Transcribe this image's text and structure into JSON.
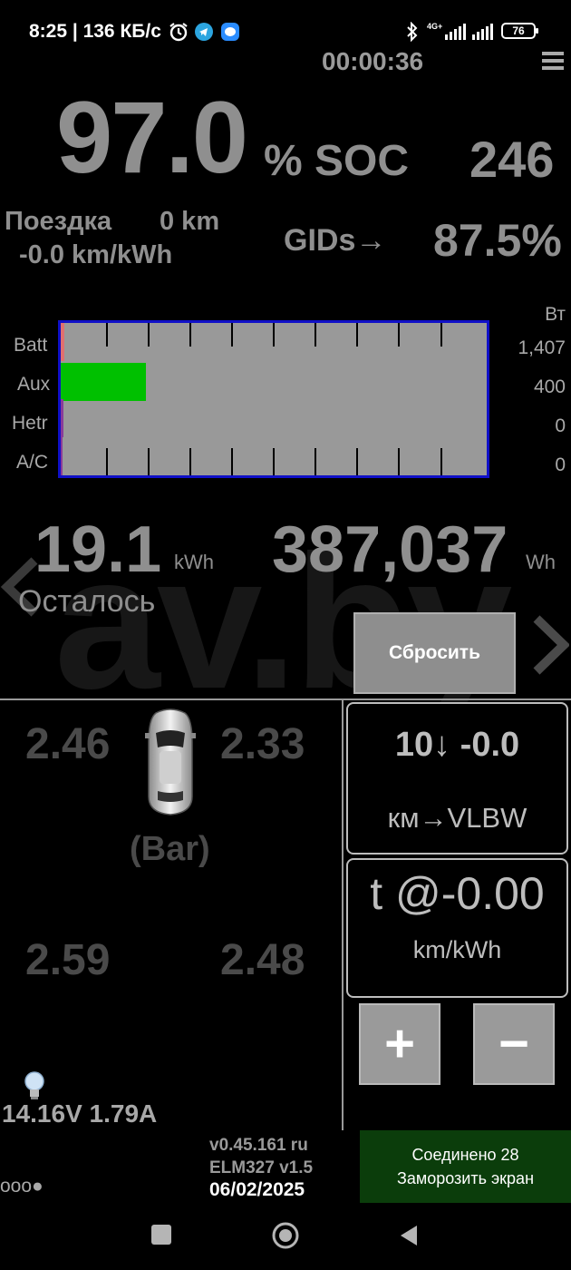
{
  "status_bar": {
    "time": "8:25",
    "net_speed": "136 КБ/с",
    "network": "4G+",
    "battery": "76"
  },
  "header": {
    "timer": "00:00:36"
  },
  "soc": {
    "value": "97.0",
    "unit": "% SOC",
    "gids": "246"
  },
  "trip": {
    "label": "Поездка",
    "distance": "0 km",
    "efficiency": "-0.0 km/kWh",
    "gids_label": "GIDs",
    "gids_arrow": "→",
    "gids_percent": "87.5%"
  },
  "power_chart": {
    "unit_label": "Вт",
    "rows": [
      {
        "label": "Batt",
        "value": "1,407",
        "fill_fraction": 0.008,
        "color": "#e07070"
      },
      {
        "label": "Aux",
        "value": "400",
        "fill_fraction": 0.2,
        "color": "#00c000"
      },
      {
        "label": "Hetr",
        "value": "0",
        "fill_fraction": 0.004,
        "color": "#8a3a9a"
      },
      {
        "label": "A/C",
        "value": "0",
        "fill_fraction": 0.0,
        "color": "#8a3a9a"
      }
    ]
  },
  "energy": {
    "remaining": "19.1",
    "remaining_unit": "kWh",
    "total": "387,037",
    "total_unit": "Wh",
    "remaining_label": "Осталось",
    "reset_button": "Сбросить"
  },
  "watermark": "av.by",
  "tires": {
    "front_left": "2.46",
    "front_right": "2.33",
    "rear_left": "2.59",
    "rear_right": "2.48",
    "unit": "(Bar)"
  },
  "range_box": {
    "top": "10↓ -0.0",
    "bottom": "км→VLBW"
  },
  "eff_box": {
    "top": "t @-0.00",
    "bottom": "km/kWh"
  },
  "controls": {
    "plus": "+",
    "minus": "−"
  },
  "aux_battery": "14.16V 1.79A",
  "dots": "ooo●",
  "version": {
    "app": "v0.45.161 ru",
    "adapter": "ELM327 v1.5",
    "date": "06/02/2025"
  },
  "connection": {
    "line1": "Соединено 28",
    "line2": "Заморозить экран"
  }
}
